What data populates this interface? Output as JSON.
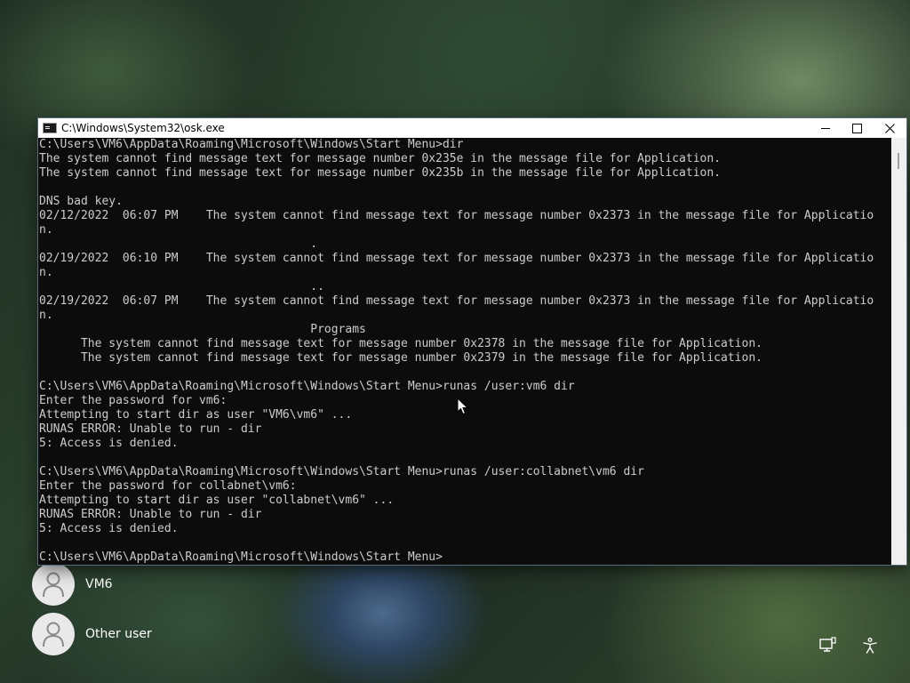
{
  "window": {
    "title": "C:\\Windows\\System32\\osk.exe",
    "icon": "console-icon",
    "controls": {
      "minimize": "minimize-icon",
      "maximize": "maximize-icon",
      "close": "close-icon"
    }
  },
  "console": {
    "lines": [
      "C:\\Users\\VM6\\AppData\\Roaming\\Microsoft\\Windows\\Start Menu>dir",
      "The system cannot find message text for message number 0x235e in the message file for Application.",
      "The system cannot find message text for message number 0x235b in the message file for Application.",
      "",
      "DNS bad key.",
      "02/12/2022  06:07 PM    The system cannot find message text for message number 0x2373 in the message file for Applicatio",
      "n.",
      "                                       .",
      "02/19/2022  06:10 PM    The system cannot find message text for message number 0x2373 in the message file for Applicatio",
      "n.",
      "                                       ..",
      "02/19/2022  06:07 PM    The system cannot find message text for message number 0x2373 in the message file for Applicatio",
      "n.",
      "                                       Programs",
      "      The system cannot find message text for message number 0x2378 in the message file for Application.",
      "      The system cannot find message text for message number 0x2379 in the message file for Application.",
      "",
      "C:\\Users\\VM6\\AppData\\Roaming\\Microsoft\\Windows\\Start Menu>runas /user:vm6 dir",
      "Enter the password for vm6:",
      "Attempting to start dir as user \"VM6\\vm6\" ...",
      "RUNAS ERROR: Unable to run - dir",
      "5: Access is denied.",
      "",
      "C:\\Users\\VM6\\AppData\\Roaming\\Microsoft\\Windows\\Start Menu>runas /user:collabnet\\vm6 dir",
      "Enter the password for collabnet\\vm6:",
      "Attempting to start dir as user \"collabnet\\vm6\" ...",
      "RUNAS ERROR: Unable to run - dir",
      "5: Access is denied.",
      "",
      "C:\\Users\\VM6\\AppData\\Roaming\\Microsoft\\Windows\\Start Menu>"
    ]
  },
  "users": [
    {
      "name": "VM6",
      "icon": "user-avatar-icon"
    },
    {
      "name": "Other user",
      "icon": "user-avatar-icon"
    }
  ],
  "corner_icons": {
    "network": "network-icon",
    "accessibility": "accessibility-icon"
  },
  "colors": {
    "console_background": "#0c0c0c",
    "console_text": "#cccccc",
    "titlebar": "#ffffff"
  }
}
